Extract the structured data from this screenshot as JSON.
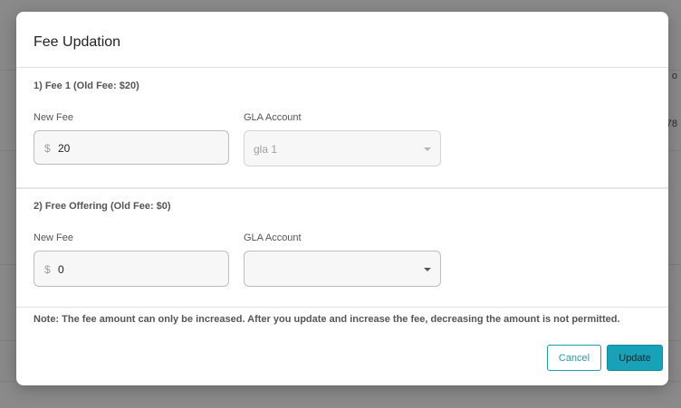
{
  "background": {
    "partial_text_1": "o",
    "partial_text_2": "78"
  },
  "modal": {
    "title": "Fee Updation",
    "fees": [
      {
        "section_title": "1) Fee 1 (Old Fee: $20)",
        "new_fee_label": "New Fee",
        "currency_symbol": "$",
        "new_fee_value": "20",
        "gla_label": "GLA Account",
        "gla_value": "gla 1",
        "gla_disabled": true
      },
      {
        "section_title": "2) Free Offering (Old Fee: $0)",
        "new_fee_label": "New Fee",
        "currency_symbol": "$",
        "new_fee_value": "0",
        "gla_label": "GLA Account",
        "gla_value": "",
        "gla_disabled": false
      }
    ],
    "note": "Note: The fee amount can only be increased. After you update and increase the fee, decreasing the amount is not permitted.",
    "cancel_label": "Cancel",
    "update_label": "Update"
  },
  "colors": {
    "accent": "#17a2b8",
    "backdrop": "#8a8a8a"
  },
  "icons": {
    "select_caret": "chevron-down-icon"
  }
}
